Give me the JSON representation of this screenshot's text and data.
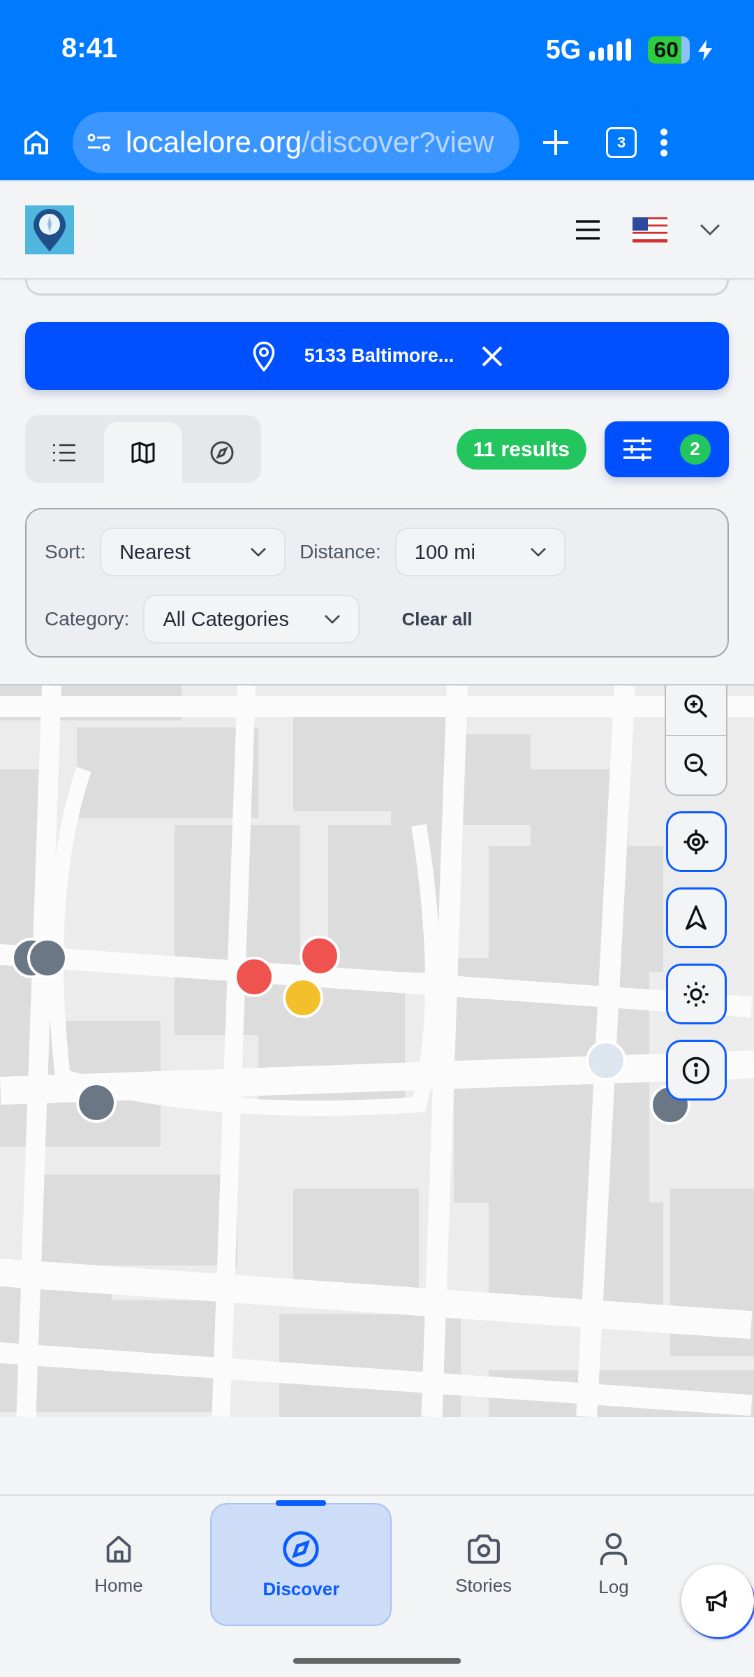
{
  "status_bar": {
    "time": "8:41",
    "network": "5G",
    "battery": "60"
  },
  "browser": {
    "url_host": "localelore.org",
    "url_path": "/discover?view",
    "tab_count": "3"
  },
  "location": {
    "label": "5133 Baltimore..."
  },
  "view_tabs": [
    {
      "kind": "list",
      "selected": false
    },
    {
      "kind": "map",
      "selected": true
    },
    {
      "kind": "compass",
      "selected": false
    }
  ],
  "results": {
    "label": "11 results"
  },
  "filter_button": {
    "badge": "2"
  },
  "filters": {
    "sort_label": "Sort:",
    "sort_value": "Nearest",
    "distance_label": "Distance:",
    "distance_value": "100 mi",
    "category_label": "Category:",
    "category_value": "All Categories",
    "clear": "Clear all"
  },
  "map": {
    "kind": "picture",
    "controls": [
      {
        "kind": "zoom-in"
      },
      {
        "kind": "zoom-out"
      },
      {
        "kind": "locate"
      },
      {
        "kind": "navigate"
      },
      {
        "kind": "theme"
      },
      {
        "kind": "info"
      }
    ]
  },
  "nav": [
    {
      "kind": "home",
      "label": "Home",
      "selected": false
    },
    {
      "kind": "discover",
      "label": "Discover",
      "selected": true
    },
    {
      "kind": "stories",
      "label": "Stories",
      "selected": false
    },
    {
      "kind": "login",
      "label": "Log",
      "selected": false
    }
  ]
}
